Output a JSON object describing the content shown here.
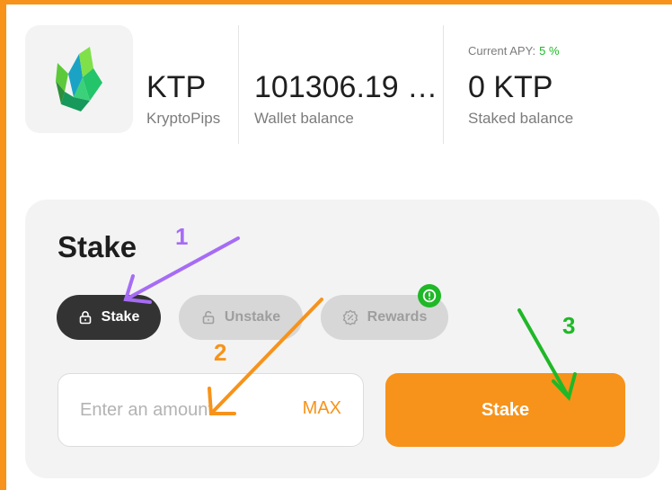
{
  "token": {
    "symbol": "KTP",
    "name": "KryptoPips",
    "logo_icon": "crystal-logo-icon"
  },
  "wallet": {
    "balance": "101306.19 …",
    "label": "Wallet balance"
  },
  "staking": {
    "apy_label": "Current APY:",
    "apy_value": "5 %",
    "staked_balance": "0 KTP",
    "staked_label": "Staked balance"
  },
  "stake_card": {
    "title": "Stake",
    "tabs": [
      {
        "label": "Stake",
        "icon": "lock-icon",
        "active": true
      },
      {
        "label": "Unstake",
        "icon": "unlock-icon",
        "active": false
      },
      {
        "label": "Rewards",
        "icon": "badge-percent-icon",
        "active": false
      }
    ],
    "rewards_badge_icon": "exclamation-icon",
    "amount_placeholder": "Enter an amount",
    "max_label": "MAX",
    "submit_label": "Stake"
  },
  "annotations": [
    {
      "number": "1",
      "color": "#a66cf5"
    },
    {
      "number": "2",
      "color": "#f7931a"
    },
    {
      "number": "3",
      "color": "#1fb827"
    }
  ],
  "colors": {
    "accent": "#f7931a",
    "active_tab": "#333333",
    "positive": "#1fb827",
    "card_background": "#f3f3f3"
  }
}
